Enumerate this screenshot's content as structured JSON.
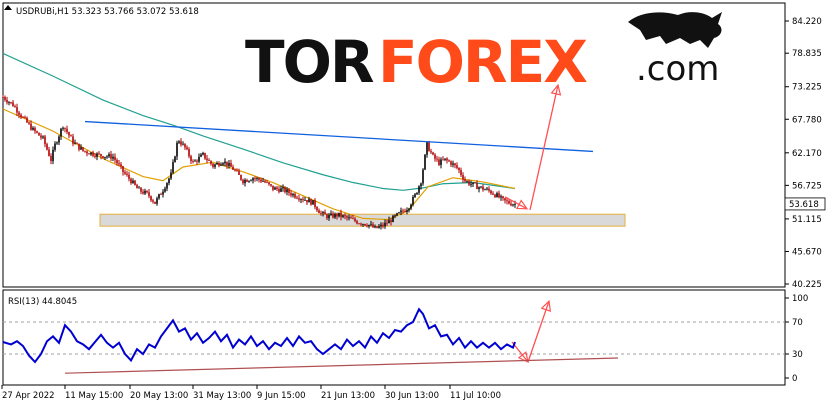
{
  "header": {
    "symbol": "USDRUBi,H1",
    "ohlc": "53.323 53.766 53.072 53.618"
  },
  "logo": {
    "part1": "TOR",
    "part2": "FOREX",
    "part3": ".com"
  },
  "colors": {
    "bull_candle": "#000000",
    "bear_candle": "#b00000",
    "ma_fast": "#e0a000",
    "ma_slow": "#20a090",
    "trendline": "#1060e0",
    "zone_fill": "#d9d9d9",
    "zone_border": "#e6b040",
    "arrow": "#ff5050",
    "rsi_line": "#0000d0",
    "support_line": "#b05050",
    "logo_dark": "#111111",
    "logo_accent": "#ff4a1a"
  },
  "chart_data": [
    {
      "type": "candlestick",
      "title": "USDRUBi,H1",
      "current_price": 53.618,
      "y_ticks": [
        84.22,
        78.835,
        73.225,
        67.78,
        62.17,
        56.725,
        51.115,
        45.67,
        40.225
      ],
      "y_tick_labels": [
        "84.220",
        "78.835",
        "73.225",
        "67.780",
        "62.170",
        "56.725",
        "51.115",
        "45.670",
        "40.225"
      ],
      "ylim": [
        40.225,
        84.22
      ],
      "x_tick_labels": [
        "27 Apr 2022",
        "11 May 15:00",
        "20 May 13:00",
        "31 May 13:00",
        "9 Jun 15:00",
        "21 Jun 13:00",
        "30 Jun 13:00",
        "11 Jul 10:00"
      ],
      "price_path": [
        [
          0,
          71.5
        ],
        [
          10,
          70.2
        ],
        [
          20,
          68.0
        ],
        [
          30,
          66.0
        ],
        [
          40,
          64.5
        ],
        [
          48,
          61.0
        ],
        [
          52,
          63.5
        ],
        [
          60,
          66.8
        ],
        [
          70,
          64.0
        ],
        [
          80,
          62.5
        ],
        [
          95,
          61.8
        ],
        [
          110,
          61.5
        ],
        [
          120,
          59.0
        ],
        [
          128,
          57.5
        ],
        [
          135,
          56.0
        ],
        [
          145,
          55.2
        ],
        [
          152,
          53.8
        ],
        [
          160,
          56.0
        ],
        [
          168,
          58.5
        ],
        [
          175,
          64.5
        ],
        [
          182,
          63.0
        ],
        [
          190,
          60.5
        ],
        [
          200,
          61.8
        ],
        [
          210,
          60.0
        ],
        [
          220,
          60.8
        ],
        [
          230,
          59.5
        ],
        [
          240,
          57.5
        ],
        [
          250,
          58.0
        ],
        [
          260,
          57.5
        ],
        [
          270,
          56.2
        ],
        [
          280,
          56.0
        ],
        [
          290,
          55.2
        ],
        [
          300,
          54.5
        ],
        [
          310,
          53.8
        ],
        [
          318,
          52.0
        ],
        [
          325,
          51.5
        ],
        [
          335,
          51.8
        ],
        [
          345,
          51.2
        ],
        [
          355,
          50.6
        ],
        [
          365,
          50.2
        ],
        [
          372,
          49.5
        ],
        [
          380,
          50.0
        ],
        [
          390,
          51.2
        ],
        [
          398,
          52.2
        ],
        [
          405,
          53.0
        ],
        [
          412,
          55.0
        ],
        [
          418,
          57.5
        ],
        [
          424,
          63.5
        ],
        [
          430,
          61.5
        ],
        [
          436,
          60.5
        ],
        [
          442,
          61.0
        ],
        [
          448,
          60.5
        ],
        [
          455,
          59.5
        ],
        [
          462,
          57.5
        ],
        [
          470,
          56.8
        ],
        [
          478,
          56.3
        ],
        [
          486,
          55.8
        ],
        [
          494,
          55.0
        ],
        [
          500,
          54.2
        ],
        [
          506,
          53.8
        ],
        [
          512,
          53.6
        ]
      ],
      "ma_fast": [
        [
          0,
          69.5
        ],
        [
          50,
          65.8
        ],
        [
          100,
          61.2
        ],
        [
          140,
          58.2
        ],
        [
          160,
          57.5
        ],
        [
          180,
          59.8
        ],
        [
          210,
          60.6
        ],
        [
          240,
          59.0
        ],
        [
          270,
          57.2
        ],
        [
          300,
          55.0
        ],
        [
          330,
          52.8
        ],
        [
          360,
          51.2
        ],
        [
          385,
          51.0
        ],
        [
          405,
          52.5
        ],
        [
          425,
          56.5
        ],
        [
          450,
          58.0
        ],
        [
          480,
          57.3
        ],
        [
          512,
          56.2
        ]
      ],
      "ma_slow": [
        [
          0,
          78.8
        ],
        [
          50,
          75.0
        ],
        [
          100,
          71.0
        ],
        [
          140,
          68.4
        ],
        [
          170,
          66.8
        ],
        [
          200,
          65.0
        ],
        [
          240,
          62.8
        ],
        [
          280,
          60.5
        ],
        [
          320,
          58.5
        ],
        [
          350,
          57.2
        ],
        [
          380,
          56.2
        ],
        [
          400,
          55.9
        ],
        [
          420,
          56.3
        ],
        [
          440,
          57.0
        ],
        [
          470,
          57.2
        ],
        [
          512,
          56.2
        ]
      ],
      "trendline": [
        [
          85,
          67.4
        ],
        [
          593,
          62.4
        ]
      ],
      "support_zone": [
        51.9,
        49.9
      ],
      "arrow_target": 73.5
    },
    {
      "type": "line",
      "title": "RSI(13) 44.8045",
      "ylim": [
        0,
        100
      ],
      "y_ticks": [
        100,
        70,
        30,
        0
      ],
      "y_tick_labels": [
        "100",
        "70",
        "30",
        "0"
      ],
      "values": [
        [
          0,
          45
        ],
        [
          8,
          42
        ],
        [
          14,
          46
        ],
        [
          20,
          40
        ],
        [
          26,
          28
        ],
        [
          32,
          20
        ],
        [
          38,
          30
        ],
        [
          44,
          46
        ],
        [
          50,
          52
        ],
        [
          56,
          44
        ],
        [
          62,
          66
        ],
        [
          68,
          58
        ],
        [
          74,
          46
        ],
        [
          80,
          42
        ],
        [
          86,
          36
        ],
        [
          92,
          45
        ],
        [
          98,
          54
        ],
        [
          104,
          44
        ],
        [
          110,
          38
        ],
        [
          116,
          44
        ],
        [
          122,
          30
        ],
        [
          128,
          22
        ],
        [
          134,
          36
        ],
        [
          140,
          30
        ],
        [
          146,
          42
        ],
        [
          152,
          38
        ],
        [
          158,
          52
        ],
        [
          164,
          62
        ],
        [
          170,
          72
        ],
        [
          176,
          58
        ],
        [
          182,
          62
        ],
        [
          188,
          48
        ],
        [
          194,
          56
        ],
        [
          200,
          44
        ],
        [
          206,
          50
        ],
        [
          212,
          58
        ],
        [
          218,
          46
        ],
        [
          224,
          54
        ],
        [
          230,
          38
        ],
        [
          236,
          48
        ],
        [
          242,
          42
        ],
        [
          248,
          52
        ],
        [
          254,
          40
        ],
        [
          260,
          46
        ],
        [
          266,
          36
        ],
        [
          272,
          44
        ],
        [
          278,
          40
        ],
        [
          284,
          50
        ],
        [
          290,
          40
        ],
        [
          296,
          52
        ],
        [
          302,
          44
        ],
        [
          308,
          46
        ],
        [
          314,
          36
        ],
        [
          320,
          30
        ],
        [
          326,
          36
        ],
        [
          332,
          42
        ],
        [
          338,
          36
        ],
        [
          344,
          48
        ],
        [
          350,
          40
        ],
        [
          356,
          46
        ],
        [
          362,
          38
        ],
        [
          368,
          52
        ],
        [
          374,
          44
        ],
        [
          380,
          56
        ],
        [
          386,
          50
        ],
        [
          392,
          60
        ],
        [
          398,
          58
        ],
        [
          404,
          66
        ],
        [
          410,
          70
        ],
        [
          416,
          86
        ],
        [
          420,
          80
        ],
        [
          426,
          62
        ],
        [
          432,
          66
        ],
        [
          438,
          52
        ],
        [
          444,
          54
        ],
        [
          450,
          42
        ],
        [
          456,
          50
        ],
        [
          462,
          38
        ],
        [
          468,
          46
        ],
        [
          474,
          38
        ],
        [
          480,
          44
        ],
        [
          486,
          38
        ],
        [
          492,
          44
        ],
        [
          498,
          36
        ],
        [
          504,
          42
        ],
        [
          510,
          38
        ],
        [
          512,
          45
        ]
      ],
      "support_line": [
        [
          65,
          6
        ],
        [
          618,
          25
        ]
      ],
      "arrow_target": 96
    }
  ]
}
